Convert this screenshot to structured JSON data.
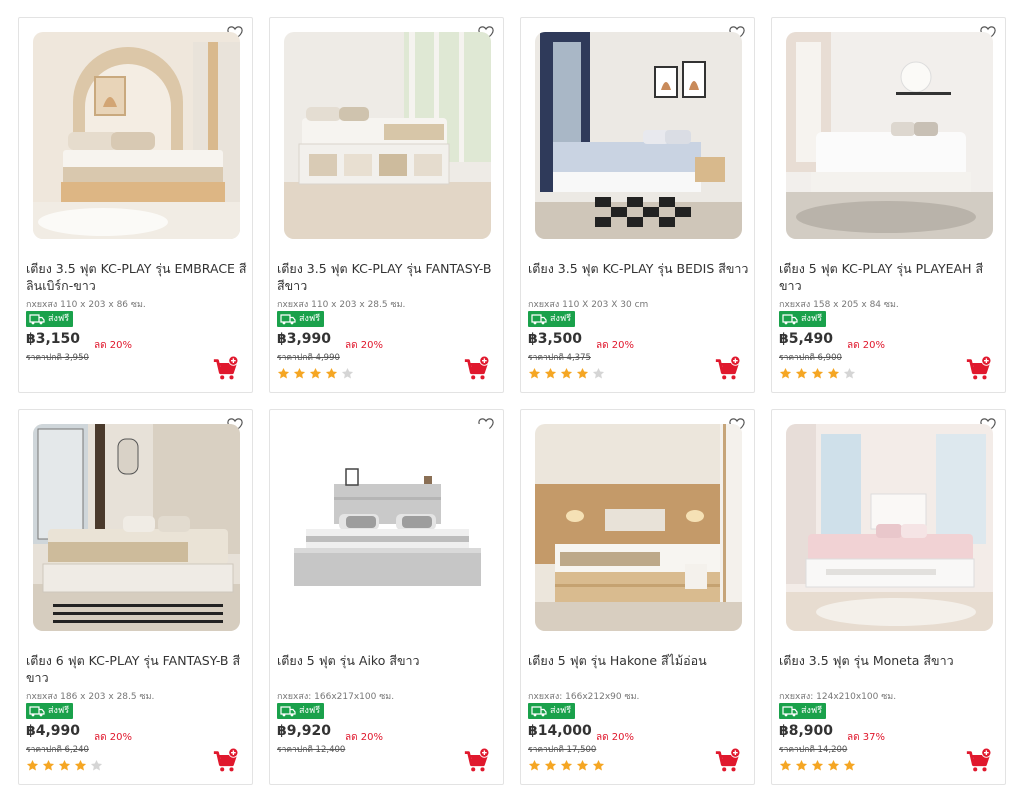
{
  "products": [
    {
      "title": "เตียง 3.5 ฟุต KC-PLAY รุ่น EMBRACE สีลินเบิร์ก-ขาว",
      "dimensions": "กxยxสง 110 x 203 x 86 ซม.",
      "shipping_label": "ส่งฟรี",
      "price": "฿3,150",
      "old_price": "ราคาปกติ 3,950",
      "discount": "ลด 20%",
      "rating": 0
    },
    {
      "title": "เตียง 3.5 ฟุต KC-PLAY รุ่น FANTASY-B สีขาว",
      "dimensions": "กxยxสง 110 x 203 x 28.5 ซม.",
      "shipping_label": "ส่งฟรี",
      "price": "฿3,990",
      "old_price": "ราคาปกติ 4,990",
      "discount": "ลด 20%",
      "rating": 4
    },
    {
      "title": "เตียง 3.5 ฟุต KC-PLAY รุ่น BEDIS สีขาว",
      "dimensions": "กxยxสง 110 X 203 X 30 cm",
      "shipping_label": "ส่งฟรี",
      "price": "฿3,500",
      "old_price": "ราคาปกติ 4,375",
      "discount": "ลด 20%",
      "rating": 4
    },
    {
      "title": "เตียง 5 ฟุต KC-PLAY รุ่น PLAYEAH สีขาว",
      "dimensions": "กxยxสง 158 x 205 x 84 ซม.",
      "shipping_label": "ส่งฟรี",
      "price": "฿5,490",
      "old_price": "ราคาปกติ 6,900",
      "discount": "ลด 20%",
      "rating": 4
    },
    {
      "title": "เตียง 6 ฟุต KC-PLAY รุ่น FANTASY-B สีขาว",
      "dimensions": "กxยxสง 186 x 203 x 28.5 ซม.",
      "shipping_label": "ส่งฟรี",
      "price": "฿4,990",
      "old_price": "ราคาปกติ 6,240",
      "discount": "ลด 20%",
      "rating": 4
    },
    {
      "title": "เตียง 5 ฟุต รุ่น Aiko สีขาว",
      "dimensions": "กxยxสง: 166x217x100 ซม.",
      "shipping_label": "ส่งฟรี",
      "price": "฿9,920",
      "old_price": "ราคาปกติ 12,400",
      "discount": "ลด 20%",
      "rating": 0
    },
    {
      "title": "เตียง 5 ฟุต รุ่น Hakone สีไม้อ่อน",
      "dimensions": "กxยxสง: 166x212x90 ซม.",
      "shipping_label": "ส่งฟรี",
      "price": "฿14,000",
      "old_price": "ราคาปกติ 17,500",
      "discount": "ลด 20%",
      "rating": 5
    },
    {
      "title": "เตียง 3.5 ฟุต รุ่น Moneta สีขาว",
      "dimensions": "กxยxสง: 124x210x100 ซม.",
      "shipping_label": "ส่งฟรี",
      "price": "฿8,900",
      "old_price": "ราคาปกติ 14,200",
      "discount": "ลด 37%",
      "rating": 5
    }
  ],
  "icons": {
    "wishlist": "heart-icon",
    "shipping": "truck-icon",
    "cart": "add-to-cart-icon",
    "rating": "star-icon"
  },
  "colors": {
    "discount": "#e0182d",
    "free_shipping_badge": "#1aa14b",
    "star_filled": "#f5a623",
    "star_empty": "#d5d5d5",
    "cart": "#e0182d"
  }
}
